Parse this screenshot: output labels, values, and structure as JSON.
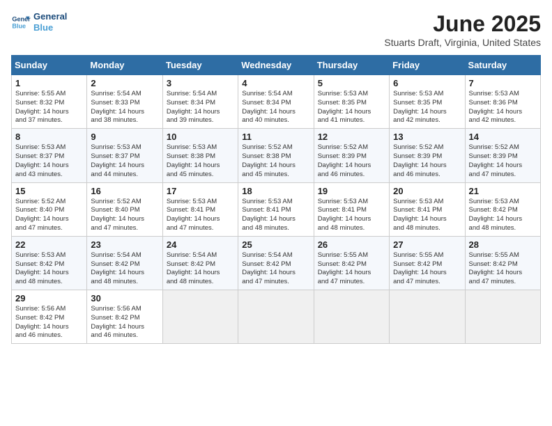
{
  "header": {
    "logo_line1": "General",
    "logo_line2": "Blue",
    "month": "June 2025",
    "location": "Stuarts Draft, Virginia, United States"
  },
  "weekdays": [
    "Sunday",
    "Monday",
    "Tuesday",
    "Wednesday",
    "Thursday",
    "Friday",
    "Saturday"
  ],
  "weeks": [
    [
      {
        "day": "1",
        "info": "Sunrise: 5:55 AM\nSunset: 8:32 PM\nDaylight: 14 hours\nand 37 minutes."
      },
      {
        "day": "2",
        "info": "Sunrise: 5:54 AM\nSunset: 8:33 PM\nDaylight: 14 hours\nand 38 minutes."
      },
      {
        "day": "3",
        "info": "Sunrise: 5:54 AM\nSunset: 8:34 PM\nDaylight: 14 hours\nand 39 minutes."
      },
      {
        "day": "4",
        "info": "Sunrise: 5:54 AM\nSunset: 8:34 PM\nDaylight: 14 hours\nand 40 minutes."
      },
      {
        "day": "5",
        "info": "Sunrise: 5:53 AM\nSunset: 8:35 PM\nDaylight: 14 hours\nand 41 minutes."
      },
      {
        "day": "6",
        "info": "Sunrise: 5:53 AM\nSunset: 8:35 PM\nDaylight: 14 hours\nand 42 minutes."
      },
      {
        "day": "7",
        "info": "Sunrise: 5:53 AM\nSunset: 8:36 PM\nDaylight: 14 hours\nand 42 minutes."
      }
    ],
    [
      {
        "day": "8",
        "info": "Sunrise: 5:53 AM\nSunset: 8:37 PM\nDaylight: 14 hours\nand 43 minutes."
      },
      {
        "day": "9",
        "info": "Sunrise: 5:53 AM\nSunset: 8:37 PM\nDaylight: 14 hours\nand 44 minutes."
      },
      {
        "day": "10",
        "info": "Sunrise: 5:53 AM\nSunset: 8:38 PM\nDaylight: 14 hours\nand 45 minutes."
      },
      {
        "day": "11",
        "info": "Sunrise: 5:52 AM\nSunset: 8:38 PM\nDaylight: 14 hours\nand 45 minutes."
      },
      {
        "day": "12",
        "info": "Sunrise: 5:52 AM\nSunset: 8:39 PM\nDaylight: 14 hours\nand 46 minutes."
      },
      {
        "day": "13",
        "info": "Sunrise: 5:52 AM\nSunset: 8:39 PM\nDaylight: 14 hours\nand 46 minutes."
      },
      {
        "day": "14",
        "info": "Sunrise: 5:52 AM\nSunset: 8:39 PM\nDaylight: 14 hours\nand 47 minutes."
      }
    ],
    [
      {
        "day": "15",
        "info": "Sunrise: 5:52 AM\nSunset: 8:40 PM\nDaylight: 14 hours\nand 47 minutes."
      },
      {
        "day": "16",
        "info": "Sunrise: 5:52 AM\nSunset: 8:40 PM\nDaylight: 14 hours\nand 47 minutes."
      },
      {
        "day": "17",
        "info": "Sunrise: 5:53 AM\nSunset: 8:41 PM\nDaylight: 14 hours\nand 47 minutes."
      },
      {
        "day": "18",
        "info": "Sunrise: 5:53 AM\nSunset: 8:41 PM\nDaylight: 14 hours\nand 48 minutes."
      },
      {
        "day": "19",
        "info": "Sunrise: 5:53 AM\nSunset: 8:41 PM\nDaylight: 14 hours\nand 48 minutes."
      },
      {
        "day": "20",
        "info": "Sunrise: 5:53 AM\nSunset: 8:41 PM\nDaylight: 14 hours\nand 48 minutes."
      },
      {
        "day": "21",
        "info": "Sunrise: 5:53 AM\nSunset: 8:42 PM\nDaylight: 14 hours\nand 48 minutes."
      }
    ],
    [
      {
        "day": "22",
        "info": "Sunrise: 5:53 AM\nSunset: 8:42 PM\nDaylight: 14 hours\nand 48 minutes."
      },
      {
        "day": "23",
        "info": "Sunrise: 5:54 AM\nSunset: 8:42 PM\nDaylight: 14 hours\nand 48 minutes."
      },
      {
        "day": "24",
        "info": "Sunrise: 5:54 AM\nSunset: 8:42 PM\nDaylight: 14 hours\nand 48 minutes."
      },
      {
        "day": "25",
        "info": "Sunrise: 5:54 AM\nSunset: 8:42 PM\nDaylight: 14 hours\nand 47 minutes."
      },
      {
        "day": "26",
        "info": "Sunrise: 5:55 AM\nSunset: 8:42 PM\nDaylight: 14 hours\nand 47 minutes."
      },
      {
        "day": "27",
        "info": "Sunrise: 5:55 AM\nSunset: 8:42 PM\nDaylight: 14 hours\nand 47 minutes."
      },
      {
        "day": "28",
        "info": "Sunrise: 5:55 AM\nSunset: 8:42 PM\nDaylight: 14 hours\nand 47 minutes."
      }
    ],
    [
      {
        "day": "29",
        "info": "Sunrise: 5:56 AM\nSunset: 8:42 PM\nDaylight: 14 hours\nand 46 minutes."
      },
      {
        "day": "30",
        "info": "Sunrise: 5:56 AM\nSunset: 8:42 PM\nDaylight: 14 hours\nand 46 minutes."
      },
      {
        "day": "",
        "info": ""
      },
      {
        "day": "",
        "info": ""
      },
      {
        "day": "",
        "info": ""
      },
      {
        "day": "",
        "info": ""
      },
      {
        "day": "",
        "info": ""
      }
    ]
  ]
}
